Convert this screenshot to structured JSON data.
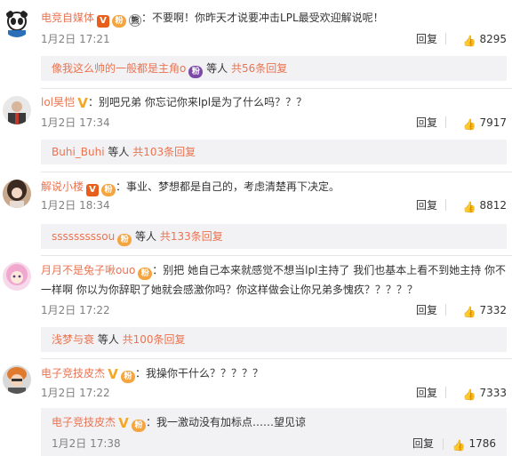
{
  "comments": [
    {
      "user": "电竞自媒体",
      "badges": [
        "V",
        "粉",
        "熊"
      ],
      "text": "：不要啊！你昨天才说要冲击LPL最受欢迎解说呢！",
      "date": "1月2日 17:21",
      "reply_label": "回复",
      "likes": "8295",
      "thread": {
        "link": "像我这么帅的一般都是主角o",
        "suffix": " 等人 ",
        "count_link": "共56条回复"
      }
    },
    {
      "user": "lol昊恺",
      "badges": [
        "V"
      ],
      "text": "：别吧兄弟 你忘记你来lpl是为了什么吗？？？",
      "date": "1月2日 17:34",
      "reply_label": "回复",
      "likes": "7917",
      "thread": {
        "link": "Buhi_Buhi",
        "suffix": " 等人 ",
        "count_link": "共103条回复"
      }
    },
    {
      "user": "解说小楼",
      "badges": [
        "V",
        "粉"
      ],
      "text": "：事业、梦想都是自己的，考虑清楚再下决定。",
      "date": "1月2日 18:34",
      "reply_label": "回复",
      "likes": "8812",
      "thread": {
        "link": "sssssssssou",
        "suffix": " 等人 ",
        "count_link": "共133条回复"
      }
    },
    {
      "user": "月月不是兔子啾ouo",
      "badges": [
        "粉"
      ],
      "text": "：别把 她自己本来就感觉不想当lpl主持了 我们也基本上看不到她主持 你不一样啊 你以为你辞职了她就会感激你吗？你这样做会让你兄弟多愧疚？？？？？",
      "date": "1月2日 17:22",
      "reply_label": "回复",
      "likes": "7332",
      "thread": {
        "link": "浅梦与衰",
        "suffix": " 等人 ",
        "count_link": "共100条回复"
      }
    },
    {
      "user": "电子竞技皮杰",
      "badges": [
        "V",
        "粉"
      ],
      "text": "：我操你干什么？？？？？",
      "date": "1月2日 17:22",
      "reply_label": "回复",
      "likes": "7333",
      "subreply": {
        "user": "电子竞技皮杰",
        "text": "：我一激动没有加标点……望见谅",
        "date": "1月2日 17:38",
        "reply_label": "回复",
        "likes": "1786"
      }
    }
  ],
  "colors": {
    "link": "#eb7350",
    "text": "#333333",
    "meta": "#808080",
    "subbox": "#f2f2f5",
    "v_badge": "#e85e1b",
    "v_yellow": "#f5a623"
  }
}
